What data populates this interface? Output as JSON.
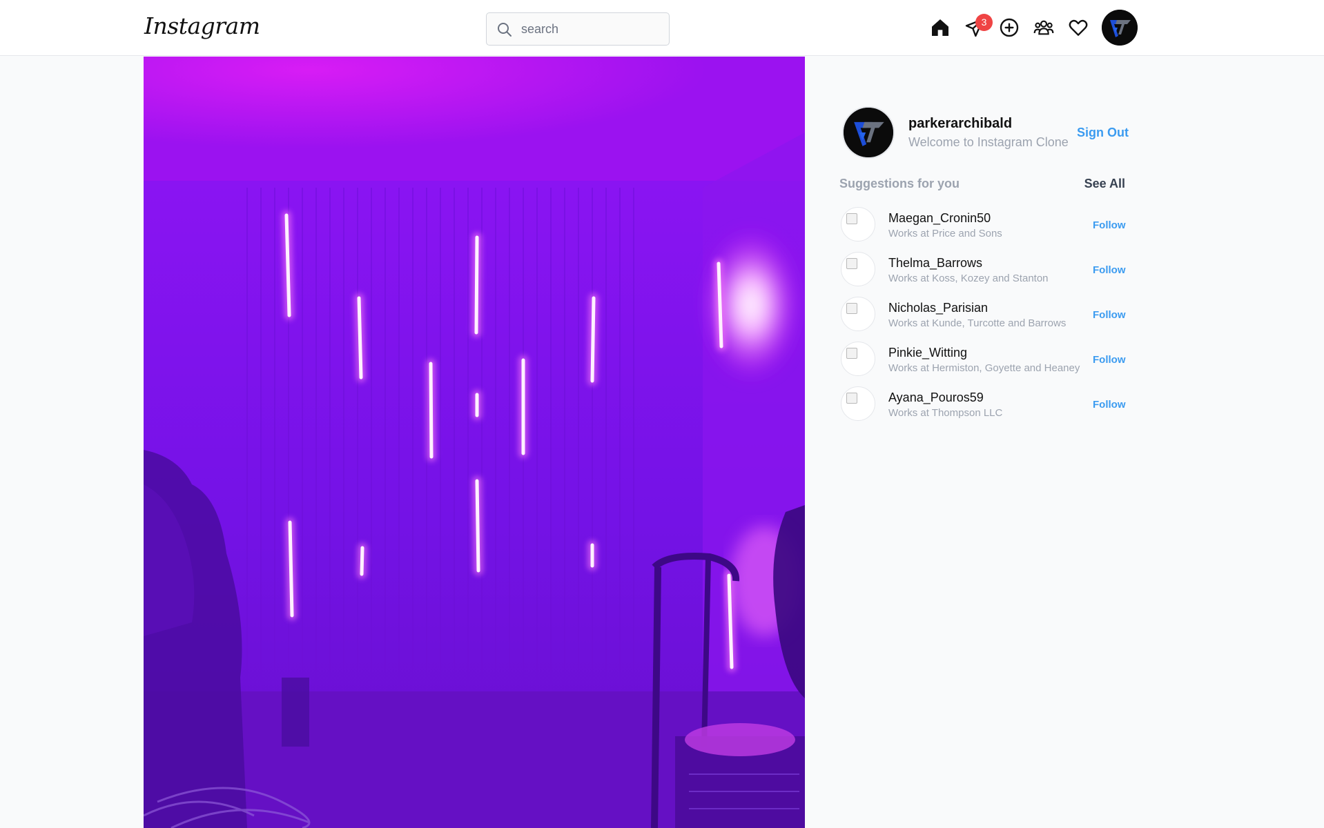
{
  "header": {
    "logo": "Instagram",
    "search_placeholder": "search",
    "messages_badge": "3",
    "icons": [
      "home-icon",
      "direct-message-icon",
      "create-post-icon",
      "people-icon",
      "heart-icon"
    ]
  },
  "profile": {
    "username": "parkerarchibald",
    "subtitle": "Welcome to Instagram Clone",
    "sign_out": "Sign Out"
  },
  "suggestions": {
    "title": "Suggestions for you",
    "see_all": "See All",
    "items": [
      {
        "name": "Maegan_Cronin50",
        "work": "Works at Price and Sons",
        "action": "Follow"
      },
      {
        "name": "Thelma_Barrows",
        "work": "Works at Koss, Kozey and Stanton",
        "action": "Follow"
      },
      {
        "name": "Nicholas_Parisian",
        "work": "Works at Kunde, Turcotte and Barrows",
        "action": "Follow"
      },
      {
        "name": "Pinkie_Witting",
        "work": "Works at Hermiston, Goyette and Heaney",
        "action": "Follow"
      },
      {
        "name": "Ayana_Pouros59",
        "work": "Works at Thompson LLC",
        "action": "Follow"
      }
    ]
  },
  "colors": {
    "accent_blue": "#3b9bf0",
    "badge_red": "#ef4444",
    "photo_purple": "#7a15e8"
  }
}
